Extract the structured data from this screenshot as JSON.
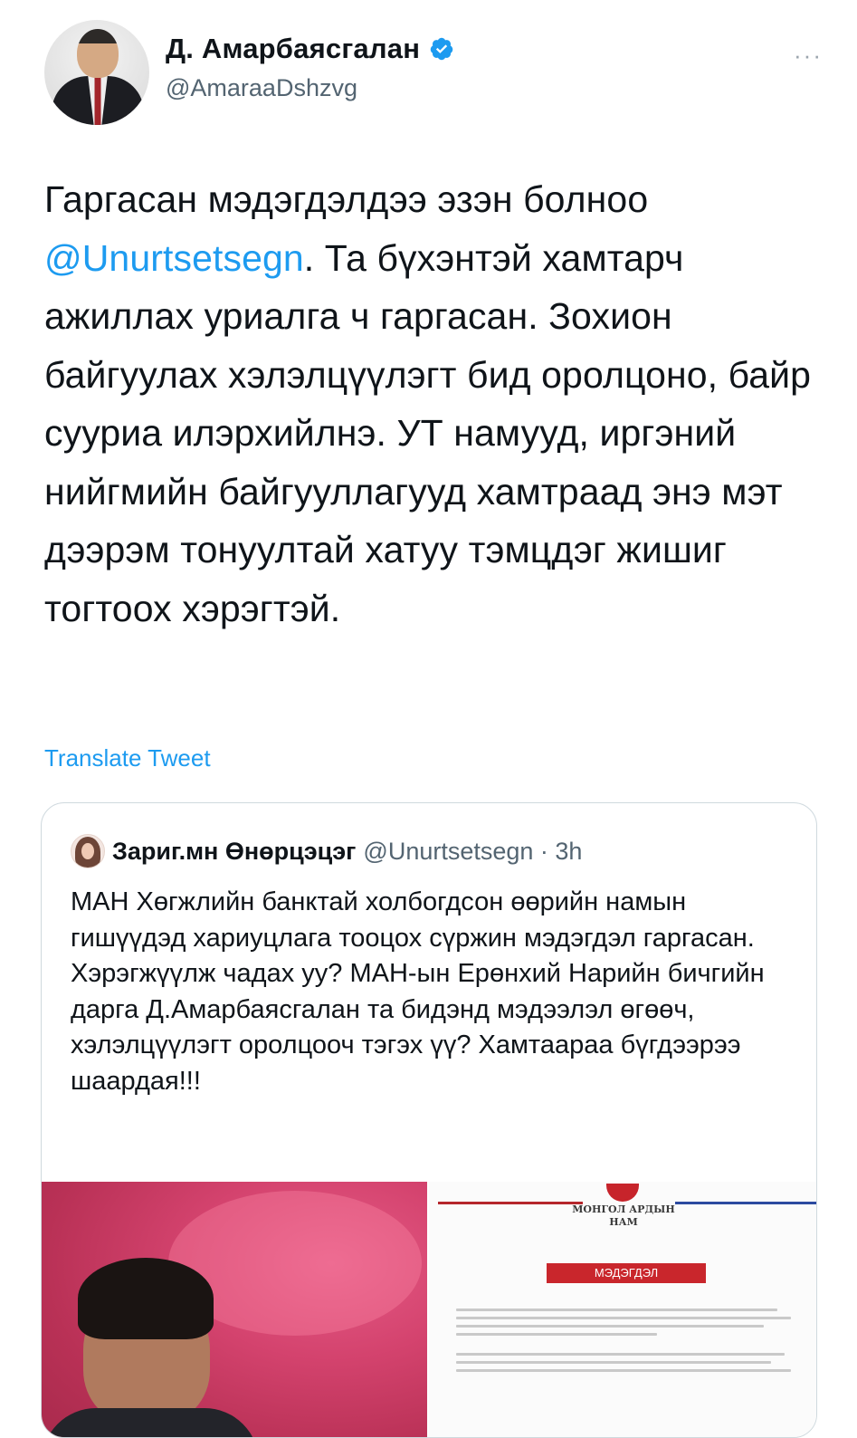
{
  "author": {
    "display_name": "Д. Амарбаясгалан",
    "handle": "@AmaraaDshzvg",
    "verified": true
  },
  "tweet": {
    "text_before_mention": "Гаргасан мэдэгдэлдээ эзэн болноо ",
    "mention": "@Unurtsetsegn",
    "text_after_mention": ".  Та бүхэнтэй хамтарч ажиллах уриалга ч гаргасан. Зохион байгуулах хэлэлцүүлэгт бид оролцоно, байр сууриа илэрхийлнэ. УТ намууд, иргэний нийгмийн байгууллагууд хамтраад энэ мэт дээрэм тонуултай хатуу тэмцдэг жишиг тогтоох хэрэгтэй.",
    "translate_label": "Translate Tweet",
    "more_label": "···"
  },
  "quoted_tweet": {
    "display_name": "Зариг.мн Өнөрцэцэг",
    "handle_time": "@Unurtsetsegn · 3h",
    "text": "МАН Хөгжлийн банктай холбогдсон өөрийн намын гишүүдэд хариуцлага тооцох сүржин мэдэгдэл гаргасан. Хэрэгжүүлж чадах уу? МАН-ын Ерөнхий Нарийн бичгийн дарга Д.Амарбаясгалан та бидэнд мэдээлэл өгөөч, хэлэлцүүлэгт оролцооч тэгэх үү? Хамтаараа бүгдээрээ шаардая!!!",
    "doc_org": "МОНГОЛ АРДЫН НАМ",
    "doc_title": "МЭДЭГДЭЛ"
  },
  "colors": {
    "accent": "#1d9bf0",
    "text": "#0f1419",
    "secondary": "#536471"
  }
}
